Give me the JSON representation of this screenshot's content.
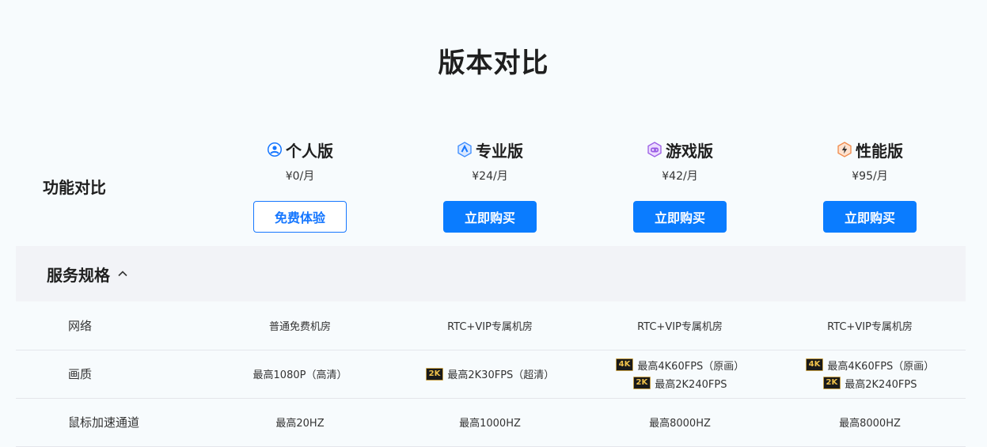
{
  "page_title": "版本对比",
  "compare_label": "功能对比",
  "plans": [
    {
      "name": "个人版",
      "price": "¥0/月",
      "button": "免费体验",
      "icon": "user-icon",
      "accent": "#1677ff"
    },
    {
      "name": "专业版",
      "price": "¥24/月",
      "button": "立即购买",
      "icon": "pro-shield-icon",
      "accent": "#3b8cff"
    },
    {
      "name": "游戏版",
      "price": "¥42/月",
      "button": "立即购买",
      "icon": "gamepad-icon",
      "accent": "#9b5de5"
    },
    {
      "name": "性能版",
      "price": "¥95/月",
      "button": "立即购买",
      "icon": "lightning-icon",
      "accent": "#f08a4b"
    }
  ],
  "section": {
    "title": "服务规格",
    "toggle_icon": "chevron-up-icon"
  },
  "rows": [
    {
      "label": "网络",
      "cells": [
        [
          {
            "text": "普通免费机房"
          }
        ],
        [
          {
            "text": "RTC+VIP专属机房"
          }
        ],
        [
          {
            "text": "RTC+VIP专属机房"
          }
        ],
        [
          {
            "text": "RTC+VIP专属机房"
          }
        ]
      ]
    },
    {
      "label": "画质",
      "cells": [
        [
          {
            "text": "最高1080P（高清）"
          }
        ],
        [
          {
            "badge": "2K",
            "text": "最高2K30FPS（超清）"
          }
        ],
        [
          {
            "badge": "4K",
            "text": "最高4K60FPS（原画）"
          },
          {
            "badge": "2K",
            "text": "最高2K240FPS"
          }
        ],
        [
          {
            "badge": "4K",
            "text": "最高4K60FPS（原画）"
          },
          {
            "badge": "2K",
            "text": "最高2K240FPS"
          }
        ]
      ]
    },
    {
      "label": "鼠标加速通道",
      "cells": [
        [
          {
            "text": "最高20HZ"
          }
        ],
        [
          {
            "text": "最高1000HZ"
          }
        ],
        [
          {
            "text": "最高8000HZ"
          }
        ],
        [
          {
            "text": "最高8000HZ"
          }
        ]
      ]
    }
  ]
}
